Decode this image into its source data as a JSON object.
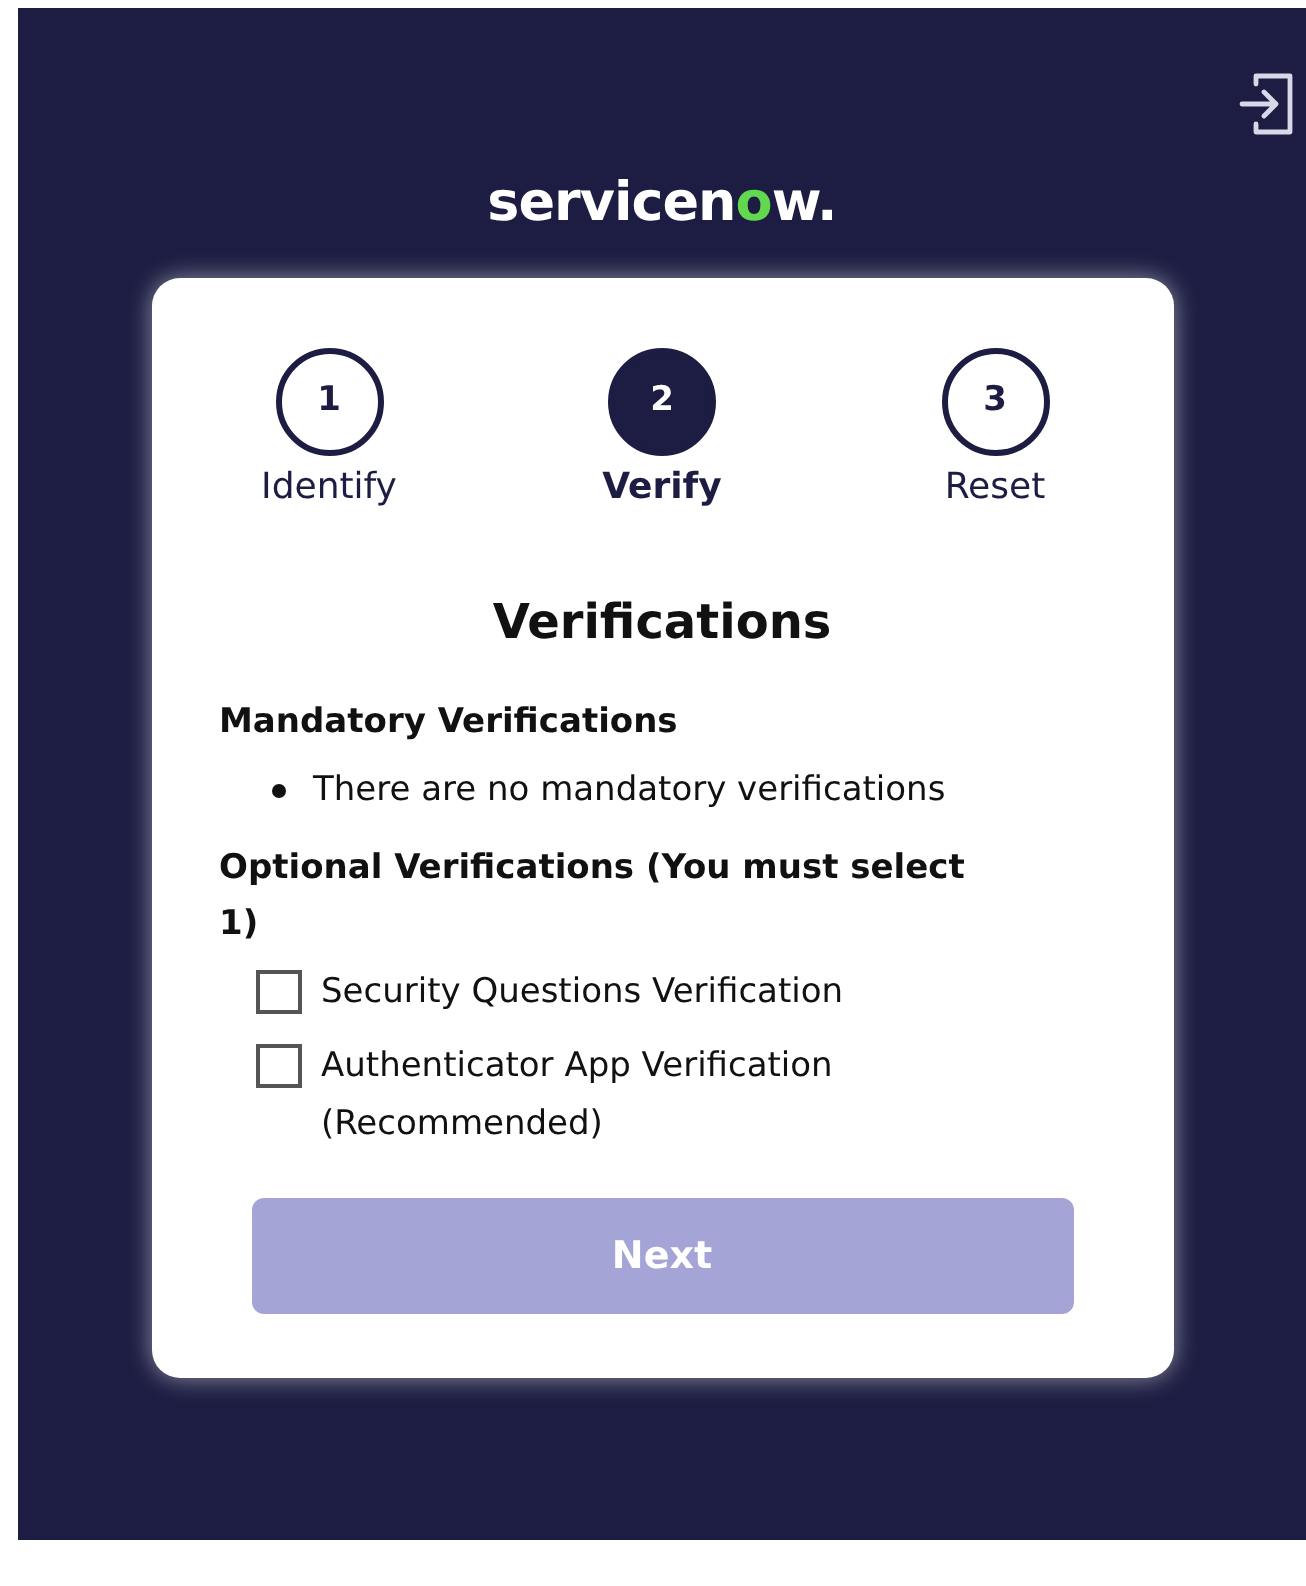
{
  "logo": {
    "before": "servicen",
    "accent": "o",
    "after": "w."
  },
  "steps": [
    {
      "number": "1",
      "label": "Identify",
      "selected": false
    },
    {
      "number": "2",
      "label": "Verify",
      "selected": true
    },
    {
      "number": "3",
      "label": "Reset",
      "selected": false
    }
  ],
  "heading": "Verifications",
  "mandatory": {
    "title": "Mandatory Verifications",
    "items": [
      "There are no mandatory verifications"
    ]
  },
  "optional": {
    "title": "Optional Verifications (You must select 1)",
    "options": [
      {
        "label": "Security Questions Verification",
        "checked": false
      },
      {
        "label": "Authenticator App Verification (Recommended)",
        "checked": false
      }
    ]
  },
  "next_button": {
    "label": "Next",
    "disabled": true
  }
}
